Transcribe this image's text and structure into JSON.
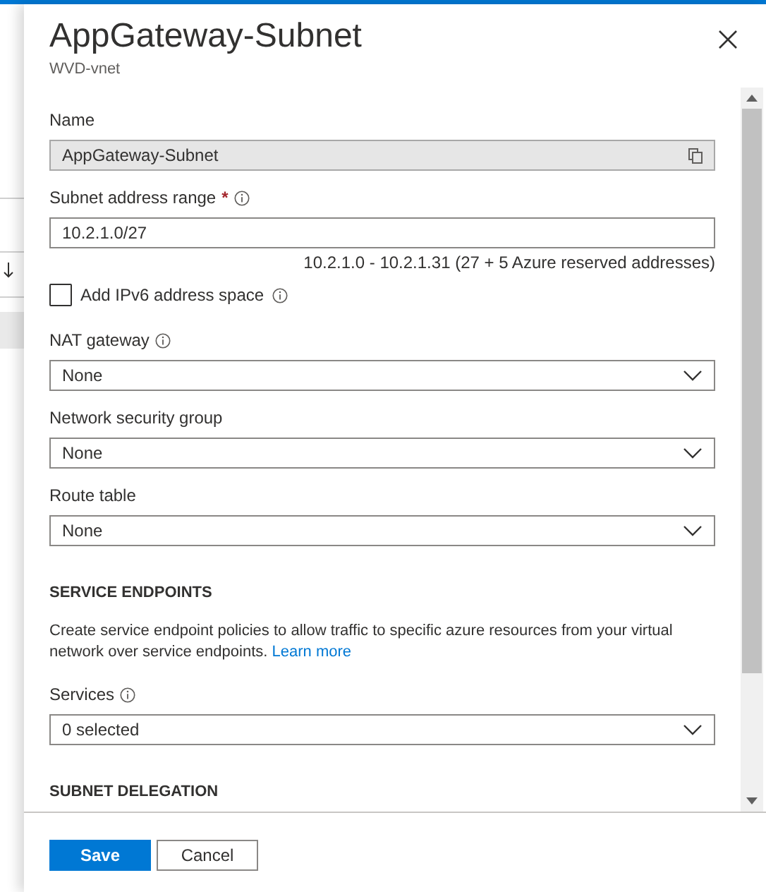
{
  "panel": {
    "title": "AppGateway-Subnet",
    "subtitle": "WVD-vnet"
  },
  "content": [
    {
      "kind": "readonly",
      "label": "Name",
      "value": "AppGateway-Subnet"
    },
    {
      "kind": "text",
      "label": "Subnet address range",
      "required": true,
      "required_mark": "*",
      "info": true,
      "value": "10.2.1.0/27",
      "hint": "10.2.1.0 - 10.2.1.31 (27 + 5 Azure reserved addresses)"
    },
    {
      "kind": "checkbox",
      "label": "Add IPv6 address space",
      "checked": false,
      "info": true
    },
    {
      "kind": "dropdown",
      "label": "NAT gateway",
      "info": true,
      "value": "None"
    },
    {
      "kind": "dropdown",
      "label": "Network security group",
      "info": false,
      "value": "None"
    },
    {
      "kind": "dropdown",
      "label": "Route table",
      "info": false,
      "value": "None"
    },
    {
      "kind": "section",
      "label": "SERVICE ENDPOINTS"
    },
    {
      "kind": "paragraph",
      "text": "Create service endpoint policies to allow traffic to specific azure resources from your virtual network over service endpoints.",
      "link": "Learn more"
    },
    {
      "kind": "dropdown",
      "label": "Services",
      "info": true,
      "value": "0 selected"
    },
    {
      "kind": "section",
      "label": "SUBNET DELEGATION"
    }
  ],
  "buttons": [
    {
      "label": "Save",
      "primary": true
    },
    {
      "label": "Cancel",
      "primary": false
    }
  ]
}
